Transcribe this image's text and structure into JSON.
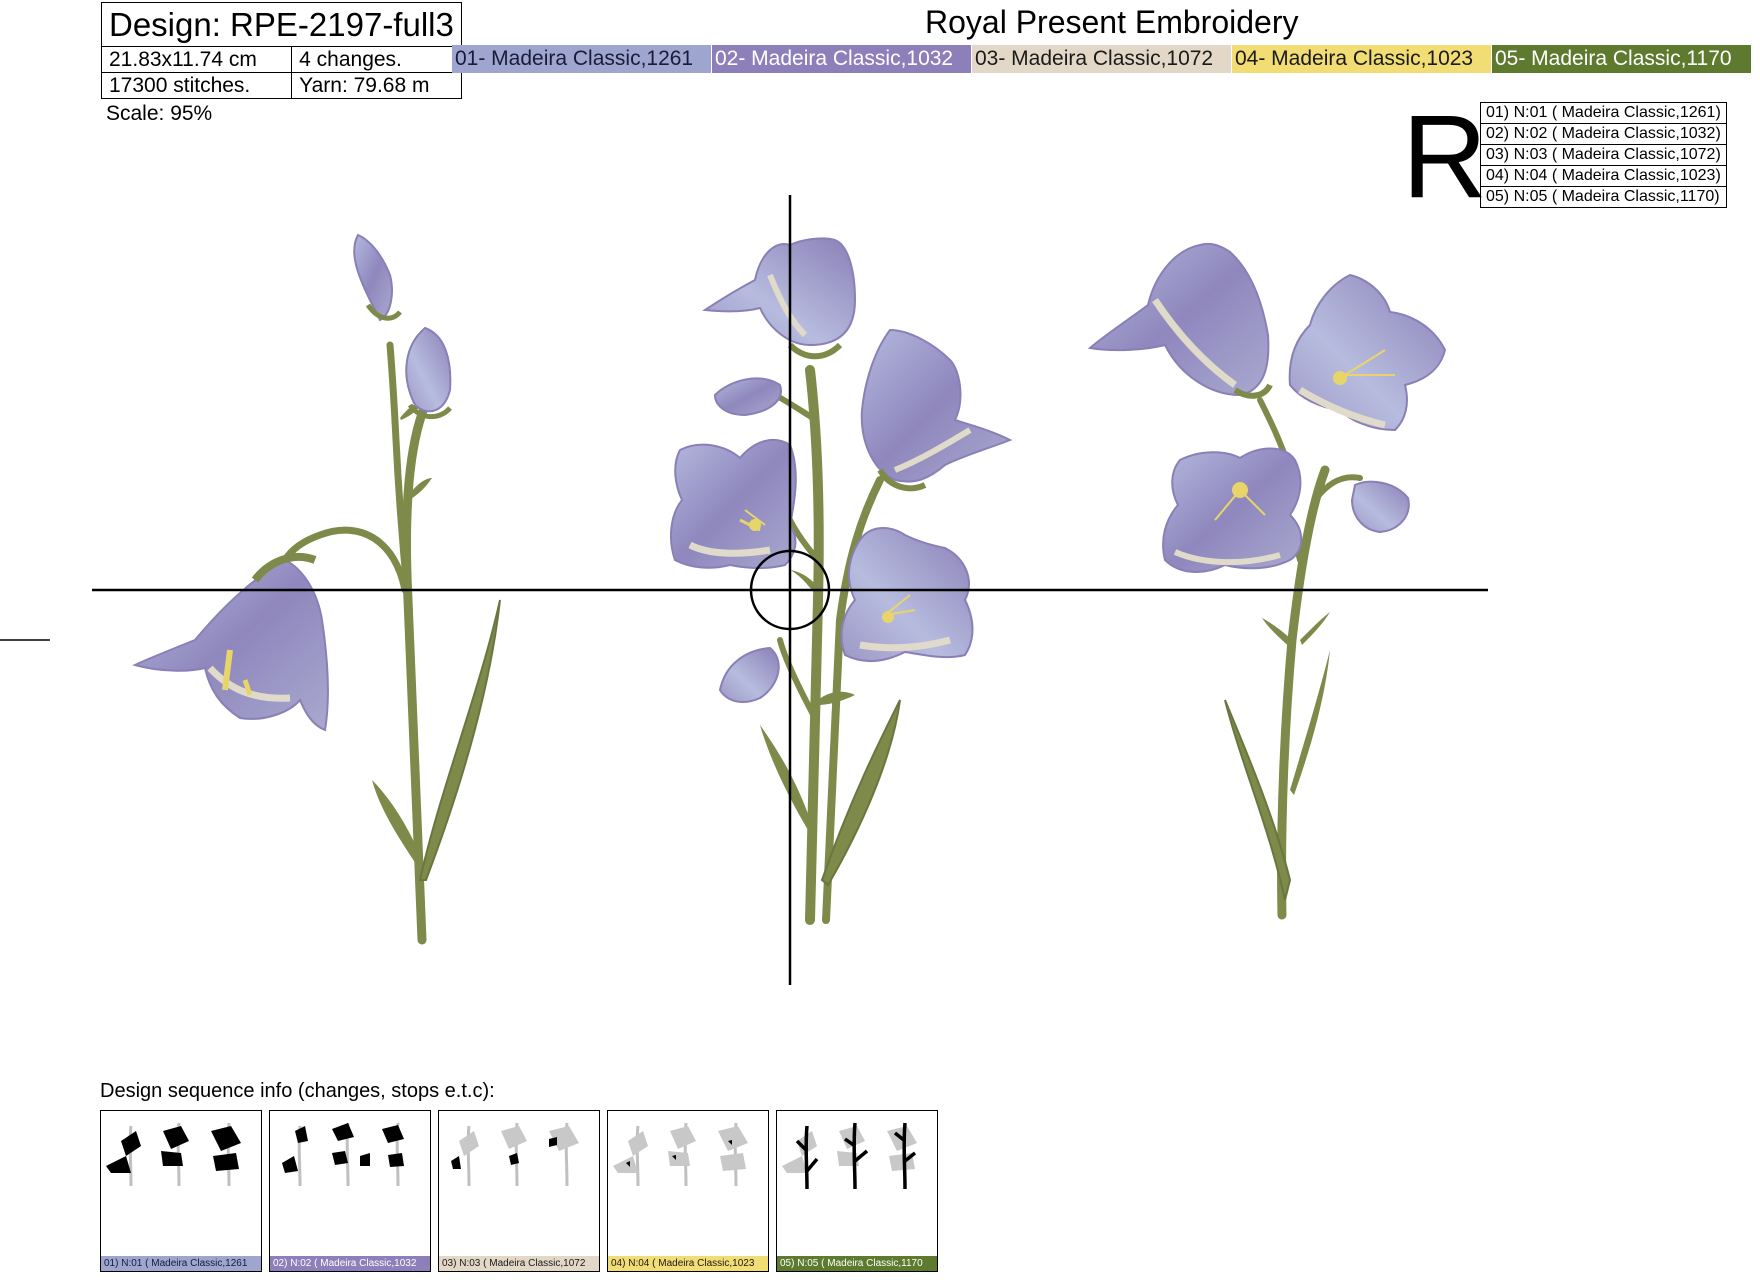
{
  "header": {
    "design_label": "Design: RPE-2197-full3",
    "size": "21.83x11.74 cm",
    "changes": "4 changes.",
    "stitches": "17300 stitches.",
    "yarn": "Yarn: 79.68 m",
    "scale": "Scale: 95%",
    "brand": "Royal Present Embroidery",
    "orientation_mark": "R"
  },
  "thread_colors": [
    {
      "label": "01- Madeira Classic,1261",
      "legend": "01) N:01 ( Madeira Classic,1261)",
      "thumb_label": "01) N:01 ( Madeira Classic,1261",
      "color": "#9ea6cf",
      "text_color": "#1a1a3a"
    },
    {
      "label": "02- Madeira Classic,1032",
      "legend": "02) N:02 ( Madeira Classic,1032)",
      "thumb_label": "02) N:02 ( Madeira Classic,1032",
      "color": "#8c7fba",
      "text_color": "#ffffff"
    },
    {
      "label": "03- Madeira Classic,1072",
      "legend": "03) N:03 ( Madeira Classic,1072)",
      "thumb_label": "03) N:03 ( Madeira Classic,1072",
      "color": "#e3d8c8",
      "text_color": "#1a1a1a"
    },
    {
      "label": "04- Madeira Classic,1023",
      "legend": "04) N:04 ( Madeira Classic,1023)",
      "thumb_label": "04) N:04 ( Madeira Classic,1023",
      "color": "#f2dc74",
      "text_color": "#1a1a1a"
    },
    {
      "label": "05- Madeira Classic,1170",
      "legend": "05) N:05 ( Madeira Classic,1170)",
      "thumb_label": "05) N:05 ( Madeira Classic,1170",
      "color": "#5e7a2e",
      "text_color": "#ffffff"
    }
  ],
  "sequence": {
    "title": "Design sequence info (changes, stops e.t.c):"
  },
  "colors": {
    "stem": "#7d8a4a",
    "petal_light": "#a6acd6",
    "petal_dark": "#8a7fb6",
    "petal_cream": "#e0dacb",
    "stamen": "#e8d56a",
    "crosshair": "#000000"
  }
}
